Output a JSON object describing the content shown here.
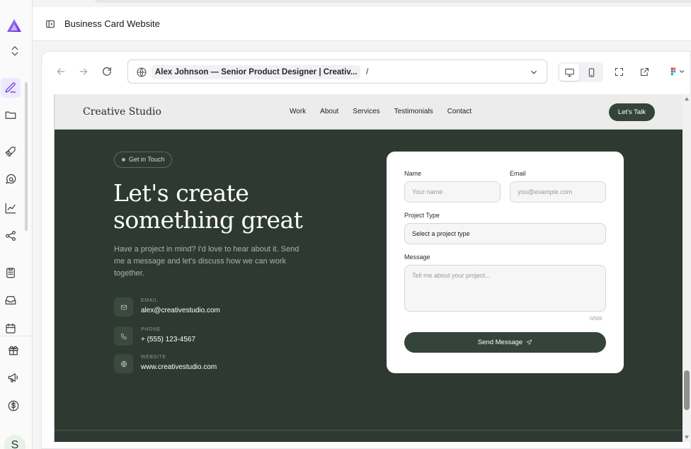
{
  "app": {
    "project_title": "Business Card Website",
    "user_initial": "S"
  },
  "sidebar": {
    "icons": [
      "logo-icon",
      "expand-collapse-icon",
      "edit-icon",
      "folder-icon",
      "rocket-icon",
      "search-chat-icon",
      "chart-icon",
      "share-icon",
      "clipboard-icon",
      "inbox-icon",
      "calendar-icon",
      "gift-icon",
      "megaphone-icon",
      "dollar-icon"
    ]
  },
  "browser": {
    "page_title": "Alex Johnson — Senior Product Designer | Creativ...",
    "path": "/"
  },
  "site": {
    "brand": "Creative Studio",
    "nav": [
      "Work",
      "About",
      "Services",
      "Testimonials",
      "Contact"
    ],
    "cta": "Let's Talk",
    "badge": "Get in Touch",
    "headline_line1": "Let's create",
    "headline_line2": "something great",
    "intro": "Have a project in mind? I'd love to hear about it. Send me a message and let's discuss how we can work together.",
    "contacts": [
      {
        "label": "EMAIL",
        "value": "alex@creativestudio.com",
        "icon": "mail-icon"
      },
      {
        "label": "PHONE",
        "value": "+ (555) 123-4567",
        "icon": "phone-icon"
      },
      {
        "label": "WEBSITE",
        "value": "www.creativestudio.com",
        "icon": "globe-icon"
      }
    ],
    "form": {
      "name_label": "Name",
      "name_placeholder": "Your name",
      "email_label": "Email",
      "email_placeholder": "you@example.com",
      "project_label": "Project Type",
      "project_value": "Select a project type",
      "message_label": "Message",
      "message_placeholder": "Tell me about your project...",
      "counter": "0/500",
      "submit": "Send Message"
    }
  },
  "colors": {
    "site_bg": "#2e3a31",
    "accent": "#34443a",
    "brand_purple": "#7c3aed"
  }
}
